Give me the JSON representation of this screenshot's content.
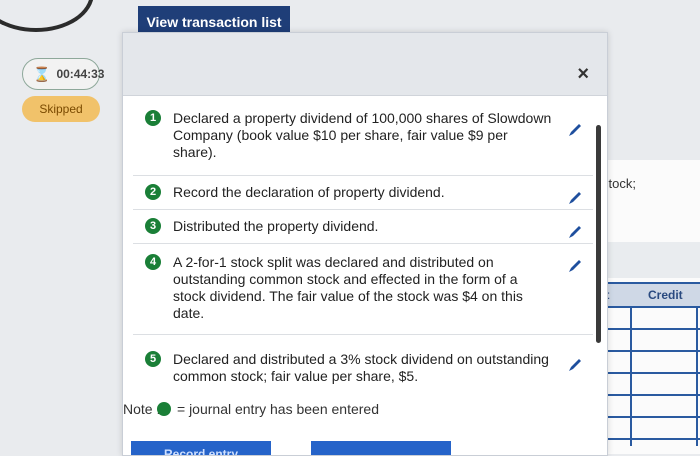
{
  "header": {
    "view_button_label": "View transaction list"
  },
  "timer": {
    "time": "00:44:33"
  },
  "status": {
    "skipped_label": "Skipped"
  },
  "background": {
    "stock_text": "stock;",
    "col_debit_partial": "it",
    "col_credit": "Credit"
  },
  "modal": {
    "close_label": "×",
    "items": [
      {
        "num": "1",
        "text": "Declared a property dividend of 100,000 shares of Slowdown Company (book value $10 per share, fair value $9 per share)."
      },
      {
        "num": "2",
        "text": "Record the declaration of property dividend."
      },
      {
        "num": "3",
        "text": "Distributed the property dividend."
      },
      {
        "num": "4",
        "text": "A 2-for-1 stock split was declared and distributed on outstanding common stock and effected in the form of a stock dividend. The fair value of the stock was $4 on this date."
      },
      {
        "num": "5",
        "text": "Declared and distributed a 3% stock dividend on outstanding common stock; fair value per share, $5."
      }
    ],
    "note_label": "Note :",
    "note_text": "= journal entry has been entered",
    "record_button_label": "Record entry"
  },
  "colors": {
    "primary": "#1f3e78",
    "accent_blue": "#2563c9",
    "check_green": "#1a7f37",
    "skipped_bg": "#f1c26a"
  }
}
